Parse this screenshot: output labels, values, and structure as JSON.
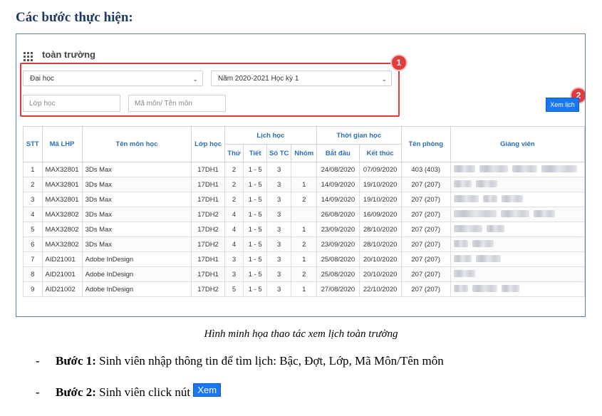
{
  "heading": "Các bước thực hiện:",
  "app": {
    "title": "toàn trường"
  },
  "filters": {
    "level": "Đại học",
    "term": "Năm 2020-2021 Học kỳ 1",
    "class_placeholder": "Lớp học",
    "subject_placeholder": "Mã môn/ Tên môn",
    "view_button": "Xem lịch",
    "badge1": "1",
    "badge2": "2"
  },
  "table": {
    "headers": {
      "stt": "STT",
      "ma_lhp": "Mã LHP",
      "ten_mon": "Tên môn học",
      "lop": "Lớp học",
      "lich_hoc": "Lịch học",
      "thu": "Thứ",
      "tiet": "Tiết",
      "so_tc": "Số TC",
      "nhom": "Nhóm",
      "thoi_gian": "Thời gian học",
      "bat_dau": "Bắt đầu",
      "ket_thuc": "Kết thúc",
      "phong": "Tên phòng",
      "giang_vien": "Giảng viên"
    },
    "rows": [
      {
        "stt": "1",
        "ma": "MAX32801",
        "ten": "3Ds Max",
        "lop": "17DH1",
        "thu": "2",
        "tiet": "1 - 5",
        "tc": "3",
        "nhom": "",
        "bd": "24/08/2020",
        "kt": "07/09/2020",
        "phong": "403 (403)"
      },
      {
        "stt": "2",
        "ma": "MAX32801",
        "ten": "3Ds Max",
        "lop": "17DH1",
        "thu": "2",
        "tiet": "1 - 5",
        "tc": "3",
        "nhom": "1",
        "bd": "14/09/2020",
        "kt": "19/10/2020",
        "phong": "207 (207)"
      },
      {
        "stt": "3",
        "ma": "MAX32801",
        "ten": "3Ds Max",
        "lop": "17DH1",
        "thu": "2",
        "tiet": "1 - 5",
        "tc": "3",
        "nhom": "2",
        "bd": "14/09/2020",
        "kt": "19/10/2020",
        "phong": "207 (207)"
      },
      {
        "stt": "4",
        "ma": "MAX32802",
        "ten": "3Ds Max",
        "lop": "17DH2",
        "thu": "4",
        "tiet": "1 - 5",
        "tc": "3",
        "nhom": "",
        "bd": "26/08/2020",
        "kt": "16/09/2020",
        "phong": "207 (207)"
      },
      {
        "stt": "5",
        "ma": "MAX32802",
        "ten": "3Ds Max",
        "lop": "17DH2",
        "thu": "4",
        "tiet": "1 - 5",
        "tc": "3",
        "nhom": "1",
        "bd": "23/09/2020",
        "kt": "28/10/2020",
        "phong": "207 (207)"
      },
      {
        "stt": "6",
        "ma": "MAX32802",
        "ten": "3Ds Max",
        "lop": "17DH2",
        "thu": "4",
        "tiet": "1 - 5",
        "tc": "3",
        "nhom": "2",
        "bd": "23/09/2020",
        "kt": "28/10/2020",
        "phong": "207 (207)"
      },
      {
        "stt": "7",
        "ma": "AID21001",
        "ten": "Adobe InDesign",
        "lop": "17DH1",
        "thu": "3",
        "tiet": "1 - 5",
        "tc": "3",
        "nhom": "1",
        "bd": "25/08/2020",
        "kt": "20/10/2020",
        "phong": "207 (207)"
      },
      {
        "stt": "8",
        "ma": "AID21001",
        "ten": "Adobe InDesign",
        "lop": "17DH1",
        "thu": "3",
        "tiet": "1 - 5",
        "tc": "3",
        "nhom": "2",
        "bd": "25/08/2020",
        "kt": "20/10/2020",
        "phong": "207 (207)"
      },
      {
        "stt": "9",
        "ma": "AID21002",
        "ten": "Adobe InDesign",
        "lop": "17DH2",
        "thu": "5",
        "tiet": "1 - 5",
        "tc": "3",
        "nhom": "1",
        "bd": "27/08/2020",
        "kt": "22/10/2020",
        "phong": "207 (207)"
      }
    ]
  },
  "caption": "Hình minh họa thao tác xem lịch toàn trường",
  "steps": [
    {
      "label": "Bước 1:",
      "text": " Sinh viên nhập thông tin để tìm lịch: Bậc, Đợt, Lớp, Mã Môn/Tên môn"
    },
    {
      "label": "Bước 2:",
      "text": " Sinh viên click nút ",
      "button": "Xem"
    }
  ],
  "icons": {
    "menu": "grid-icon",
    "dropdown": "chevron-down-icon"
  }
}
